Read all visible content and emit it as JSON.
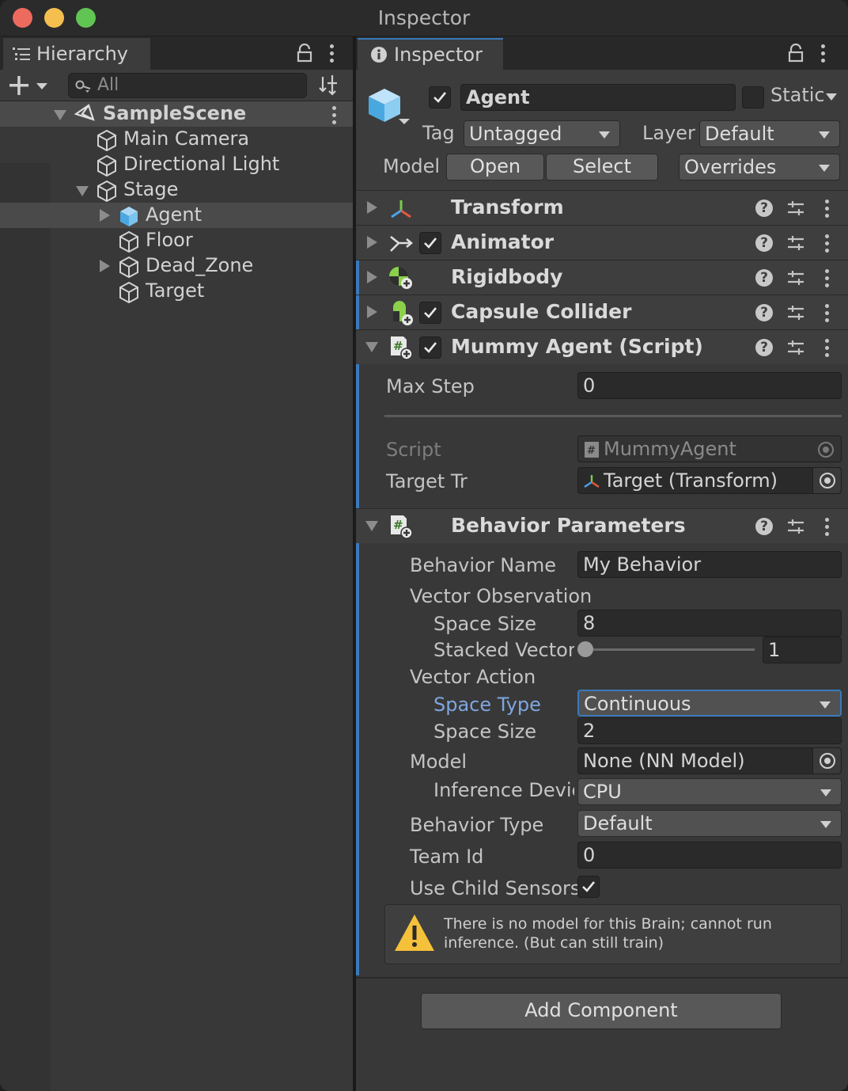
{
  "window": {
    "title": "Inspector",
    "traffic_lights": [
      "#ed6a5e",
      "#f5bf4f",
      "#61c554"
    ]
  },
  "hierarchy": {
    "tab_label": "Hierarchy",
    "search_placeholder": "All",
    "items": [
      {
        "label": "SampleScene",
        "expanded": true,
        "selected_scene": true
      },
      {
        "label": "Main Camera"
      },
      {
        "label": "Directional Light"
      },
      {
        "label": "Stage",
        "expanded": true
      },
      {
        "label": "Agent",
        "selected": true
      },
      {
        "label": "Floor"
      },
      {
        "label": "Dead_Zone"
      },
      {
        "label": "Target"
      }
    ]
  },
  "inspector": {
    "tab_label": "Inspector",
    "object_name": "Agent",
    "active": true,
    "static_label": "Static",
    "tag_label": "Tag",
    "tag_value": "Untagged",
    "layer_label": "Layer",
    "layer_value": "Default",
    "model_label": "Model",
    "open_label": "Open",
    "select_label": "Select",
    "overrides_label": "Overrides",
    "components": [
      {
        "name": "Transform",
        "has_checkbox": false,
        "icon": "transform-icon"
      },
      {
        "name": "Animator",
        "has_checkbox": true,
        "icon": "animator-icon"
      },
      {
        "name": "Rigidbody",
        "has_checkbox": false,
        "icon": "rigidbody-icon"
      },
      {
        "name": "Capsule Collider",
        "has_checkbox": true,
        "icon": "capsule-collider-icon"
      },
      {
        "name": "Mummy Agent (Script)",
        "has_checkbox": true,
        "icon": "script-icon"
      }
    ],
    "mummy": {
      "max_step_label": "Max Step",
      "max_step_value": "0",
      "script_label": "Script",
      "script_value": "MummyAgent",
      "target_label": "Target Tr",
      "target_value": "Target (Transform)"
    },
    "behavior": {
      "title": "Behavior Parameters",
      "name_label": "Behavior Name",
      "name_value": "My Behavior",
      "vector_obs_label": "Vector Observation",
      "space_size_label": "Space Size",
      "space_size_value": "8",
      "stacked_label": "Stacked Vectors",
      "stacked_value": "1",
      "stacked_fraction": 0,
      "vector_action_label": "Vector Action",
      "space_type_label": "Space Type",
      "space_type_value": "Continuous",
      "action_size_label": "Space Size",
      "action_size_value": "2",
      "model_label": "Model",
      "model_value": "None (NN Model)",
      "inference_label": "Inference Device",
      "inference_value": "CPU",
      "behavior_type_label": "Behavior Type",
      "behavior_type_value": "Default",
      "team_label": "Team Id",
      "team_value": "0",
      "child_sensors_label": "Use Child Sensors",
      "child_sensors_checked": true,
      "warning": "There is no model for this Brain; cannot run inference. (But can still train)"
    },
    "add_component_label": "Add Component"
  },
  "colors": {
    "accent": "#3a79bb",
    "selection_label": "#7fa6e0",
    "warning": "#f5c03a"
  }
}
